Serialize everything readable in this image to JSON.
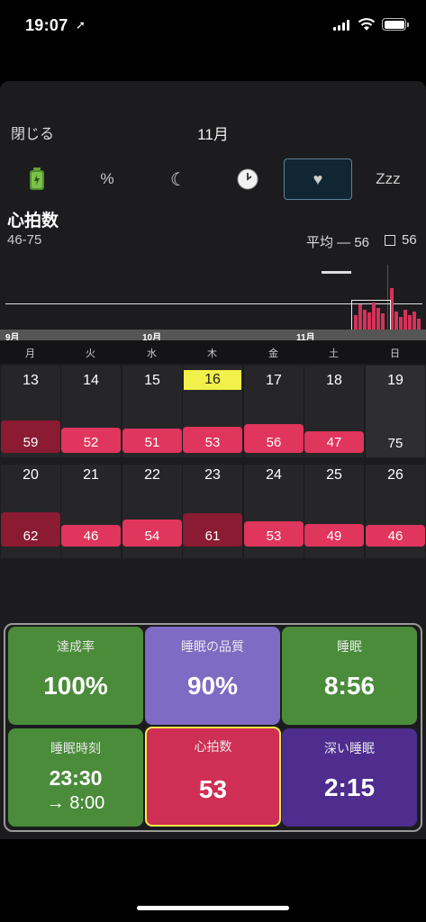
{
  "status": {
    "time": "19:07",
    "location_icon": "location-arrow-icon"
  },
  "header": {
    "close": "閉じる",
    "month": "11月"
  },
  "tabs": [
    {
      "label": "",
      "icon": "battery-icon"
    },
    {
      "label": "%",
      "icon": "percent-icon"
    },
    {
      "label": "☾",
      "icon": "moon-icon"
    },
    {
      "label": "",
      "icon": "clock-icon"
    },
    {
      "label": "♥",
      "icon": "heart-icon",
      "selected": true
    },
    {
      "label": "Zzz",
      "icon": "zzz-icon"
    }
  ],
  "metric": {
    "title": "心拍数",
    "range": "46-75",
    "avg_label": "平均 ― 56",
    "box_value": "56"
  },
  "timeline": {
    "months": [
      "9月",
      "10月",
      "11月"
    ]
  },
  "weekdays": [
    "月",
    "火",
    "水",
    "木",
    "金",
    "土",
    "日"
  ],
  "calendar": {
    "weeks": [
      {
        "dates": [
          "13",
          "14",
          "15",
          "16",
          "17",
          "18",
          "19"
        ],
        "values": [
          "59",
          "52",
          "51",
          "53",
          "56",
          "47",
          "75"
        ]
      },
      {
        "dates": [
          "20",
          "21",
          "22",
          "23",
          "24",
          "25",
          "26"
        ],
        "values": [
          "62",
          "46",
          "54",
          "61",
          "53",
          "49",
          "46"
        ]
      }
    ],
    "today_index": 3
  },
  "tiles": [
    {
      "label": "達成率",
      "value": "100%",
      "color": "#4a8c3a"
    },
    {
      "label": "睡眠の品質",
      "value": "90%",
      "color": "#7e6bc4"
    },
    {
      "label": "睡眠",
      "value": "8:56",
      "color": "#4a8c3a"
    },
    {
      "label": "睡眠時刻",
      "value": "23:30",
      "value2": "→ 8:00",
      "color": "#4a8c3a"
    },
    {
      "label": "心拍数",
      "value": "53",
      "color": "#cf2f55",
      "selected": true
    },
    {
      "label": "深い睡眠",
      "value": "2:15",
      "color": "#4e2d8e"
    }
  ],
  "colors": {
    "heart": "#e0355c",
    "heart_dark": "#8b1a33",
    "today": "#f2f04a"
  }
}
